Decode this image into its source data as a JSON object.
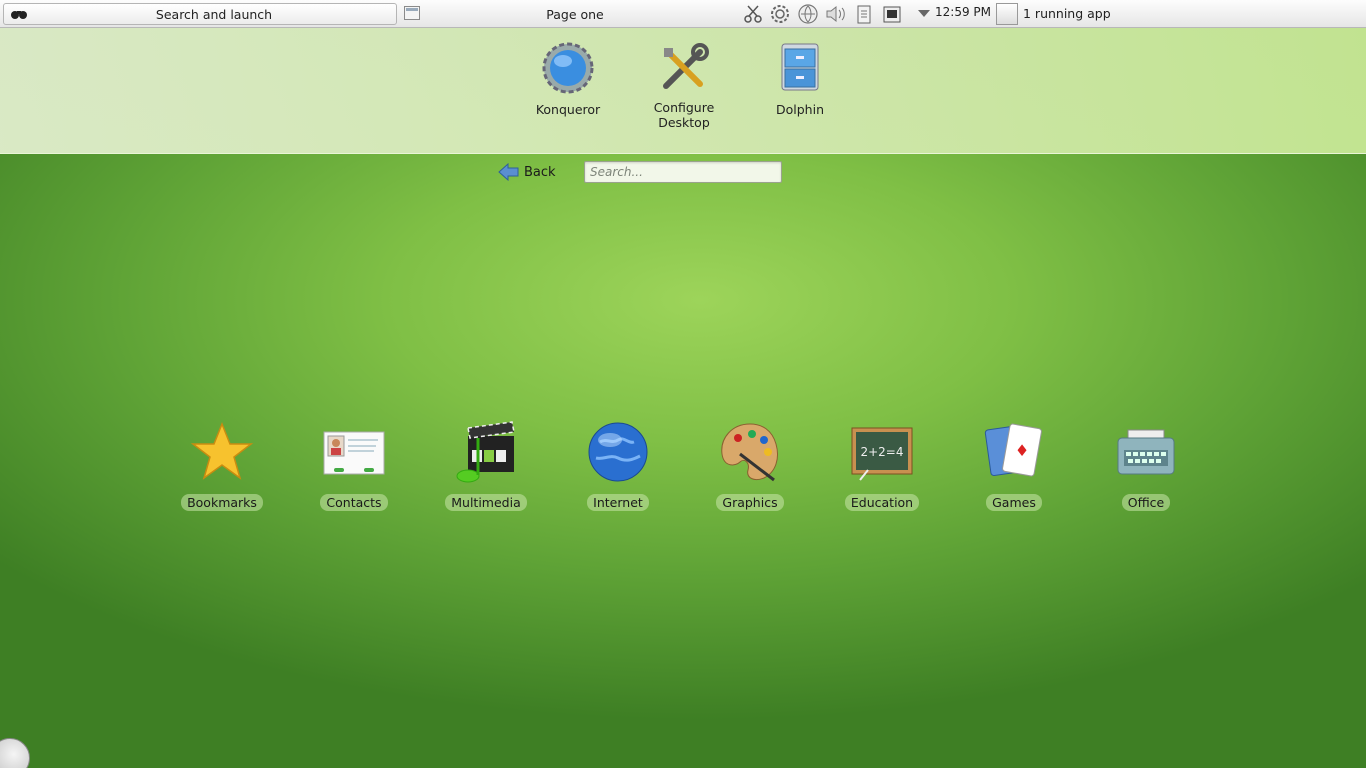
{
  "panel": {
    "launcher_label": "Search and launch",
    "page_title": "Page one",
    "clock": "12:59 PM",
    "running_apps": "1 running app"
  },
  "favorites": [
    {
      "label": "Konqueror",
      "icon": "konqueror-globe-icon"
    },
    {
      "label": "Configure\nDesktop",
      "icon": "tools-icon"
    },
    {
      "label": "Dolphin",
      "icon": "file-cabinet-icon"
    }
  ],
  "nav": {
    "back_label": "Back",
    "search_placeholder": "Search..."
  },
  "categories": [
    {
      "label": "Bookmarks",
      "icon": "star-icon"
    },
    {
      "label": "Contacts",
      "icon": "contact-card-icon"
    },
    {
      "label": "Multimedia",
      "icon": "clapperboard-icon"
    },
    {
      "label": "Internet",
      "icon": "globe-icon"
    },
    {
      "label": "Graphics",
      "icon": "palette-icon"
    },
    {
      "label": "Education",
      "icon": "chalkboard-icon"
    },
    {
      "label": "Games",
      "icon": "playing-cards-icon"
    },
    {
      "label": "Office",
      "icon": "typewriter-icon"
    }
  ]
}
